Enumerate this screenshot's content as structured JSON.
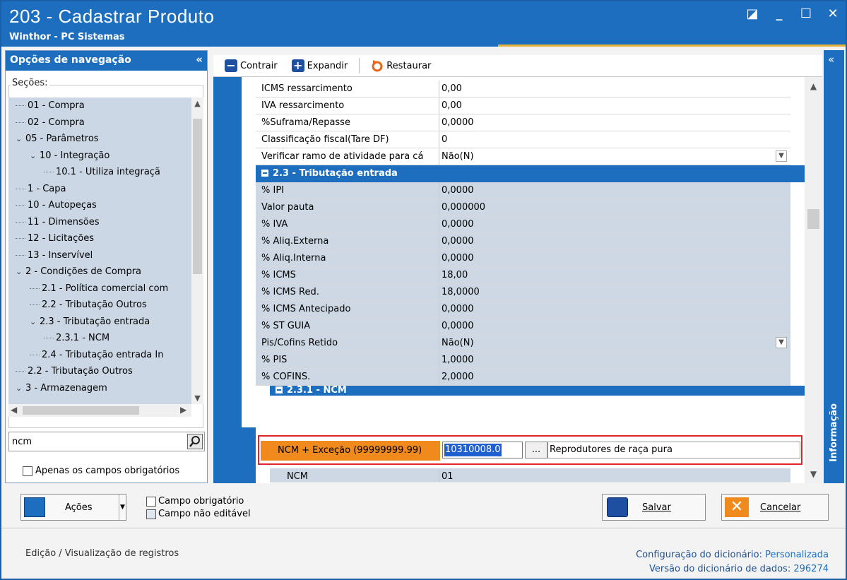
{
  "window": {
    "title": "203 - Cadastrar  Produto",
    "subtitle": "Winthor - PC Sistemas"
  },
  "nav": {
    "header": "Opções de navegação",
    "collapse_glyph": "«",
    "sections_label": "Seções:",
    "tree": [
      {
        "label": "01 - Compra",
        "level": 0,
        "expander": ""
      },
      {
        "label": "02 - Compra",
        "level": 0,
        "expander": ""
      },
      {
        "label": "05 - Parâmetros",
        "level": 0,
        "expander": "v"
      },
      {
        "label": "10 - Integração",
        "level": 1,
        "expander": "v"
      },
      {
        "label": "10.1 - Utiliza integraçã",
        "level": 2,
        "expander": ""
      },
      {
        "label": "1 - Capa",
        "level": 0,
        "expander": ""
      },
      {
        "label": "10 - Autopeças",
        "level": 0,
        "expander": ""
      },
      {
        "label": "11 - Dimensões",
        "level": 0,
        "expander": ""
      },
      {
        "label": "12 - Licitações",
        "level": 0,
        "expander": ""
      },
      {
        "label": "13 - Inservível",
        "level": 0,
        "expander": ""
      },
      {
        "label": "2 - Condições de Compra",
        "level": 0,
        "expander": "v"
      },
      {
        "label": "2.1 - Política comercial com",
        "level": 1,
        "expander": ""
      },
      {
        "label": "2.2 - Tributação Outros",
        "level": 1,
        "expander": ""
      },
      {
        "label": "2.3 - Tributação entrada",
        "level": 1,
        "expander": "v"
      },
      {
        "label": "2.3.1 - NCM",
        "level": 2,
        "expander": ""
      },
      {
        "label": "2.4 - Tributação entrada In",
        "level": 1,
        "expander": ""
      },
      {
        "label": "2.2 - Tributação Outros",
        "level": 0,
        "expander": ""
      },
      {
        "label": "3 - Armazenagem",
        "level": 0,
        "expander": "v"
      }
    ],
    "search_value": "ncm",
    "required_only_label": "Apenas os campos obrigatórios"
  },
  "toolbar": {
    "collapse_label": "Contrair",
    "expand_label": "Expandir",
    "restore_label": "Restaurar"
  },
  "grid": {
    "rows_top": [
      {
        "label": "ICMS ressarcimento",
        "value": "0,00",
        "dropdown": false
      },
      {
        "label": "IVA ressarcimento",
        "value": "0,00",
        "dropdown": false
      },
      {
        "label": "%Suframa/Repasse",
        "value": "0,0000",
        "dropdown": false
      },
      {
        "label": "Classificação fiscal(Tare DF)",
        "value": "0",
        "dropdown": false
      },
      {
        "label": "Verificar ramo de atividade para cá",
        "value": "Não(N)",
        "dropdown": true
      }
    ],
    "section_entrada": "2.3 - Tributação entrada",
    "rows_entrada": [
      {
        "label": "% IPI",
        "value": "0,0000",
        "dropdown": false
      },
      {
        "label": "Valor pauta",
        "value": "0,000000",
        "dropdown": false
      },
      {
        "label": "% IVA",
        "value": "0,0000",
        "dropdown": false
      },
      {
        "label": "% Aliq.Externa",
        "value": "0,0000",
        "dropdown": false
      },
      {
        "label": "% Aliq.Interna",
        "value": "0,0000",
        "dropdown": false
      },
      {
        "label": "% ICMS",
        "value": "18,00",
        "dropdown": false
      },
      {
        "label": "% ICMS Red.",
        "value": "18,0000",
        "dropdown": false
      },
      {
        "label": "% ICMS Antecipado",
        "value": "0,0000",
        "dropdown": false
      },
      {
        "label": "% ST GUIA",
        "value": "0,0000",
        "dropdown": false
      },
      {
        "label": "Pis/Cofins Retido",
        "value": "Não(N)",
        "dropdown": true
      },
      {
        "label": "% PIS",
        "value": "1,0000",
        "dropdown": false
      },
      {
        "label": "% COFINS.",
        "value": "2,0000",
        "dropdown": false
      }
    ],
    "section_ncm": "2.3.1 - NCM",
    "ncm_field": {
      "label": "NCM + Exceção (99999999.99)",
      "value": "10310008.0",
      "lookup_button": "...",
      "description": "Reprodutores de raça pura"
    },
    "ncm_row": {
      "label": "NCM",
      "value": "01"
    }
  },
  "info_panel": {
    "label": "Informação",
    "collapse_glyph": "«"
  },
  "footer": {
    "actions_label": "Ações",
    "legend_required": "Campo obrigatório",
    "legend_readonly": "Campo não editável",
    "save_label": "Salvar",
    "cancel_label": "Cancelar"
  },
  "status": {
    "left": "Edição / Visualização de registros",
    "config_label": "Configuração do dicionário:",
    "config_value": "Personalizada",
    "version_label": "Versão do dicionário de dados:",
    "version_value": "296274"
  }
}
